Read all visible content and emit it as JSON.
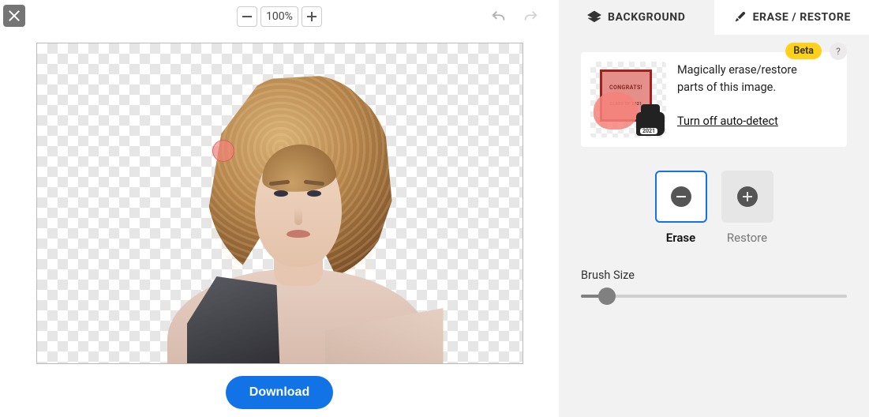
{
  "toolbar": {
    "zoom_level": "100%",
    "download_label": "Download"
  },
  "tabs": {
    "background_label": "BACKGROUND",
    "erase_restore_label": "ERASE / RESTORE"
  },
  "info_card": {
    "beta_label": "Beta",
    "help_label": "?",
    "description_line1": "Magically erase/restore",
    "description_line2": "parts of this image.",
    "turn_off_link": "Turn off auto-detect",
    "thumb_title": "CONGRATS!",
    "thumb_sub": "CLASS OF 2021"
  },
  "tools": {
    "erase_label": "Erase",
    "restore_label": "Restore"
  },
  "brush": {
    "title": "Brush Size"
  }
}
